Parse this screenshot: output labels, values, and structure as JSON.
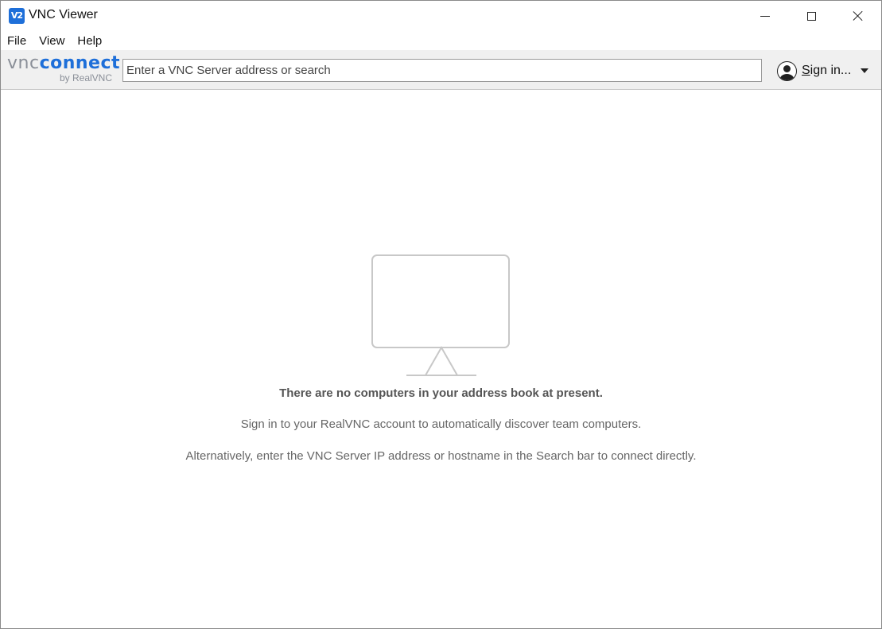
{
  "window": {
    "title": "VNC Viewer",
    "app_icon_text": "V2"
  },
  "menu": {
    "items": [
      {
        "label": "File"
      },
      {
        "label": "View"
      },
      {
        "label": "Help"
      }
    ]
  },
  "toolbar": {
    "logo": {
      "vnc": "vnc",
      "connect": "connect",
      "sub": "by RealVNC"
    },
    "search": {
      "placeholder": "Enter a VNC Server address or search",
      "value": ""
    },
    "signin": {
      "label_first": "S",
      "label_rest": "ign in..."
    }
  },
  "empty_state": {
    "icon": "monitor-icon",
    "title": "There are no computers in your address book at present.",
    "line1": "Sign in to your RealVNC account to automatically discover team computers.",
    "line2": "Alternatively, enter the VNC Server IP address or hostname in the Search bar to connect directly."
  },
  "colors": {
    "accent": "#1e6fd9",
    "toolbar_bg": "#f0f0f0",
    "muted_text": "#666666"
  }
}
